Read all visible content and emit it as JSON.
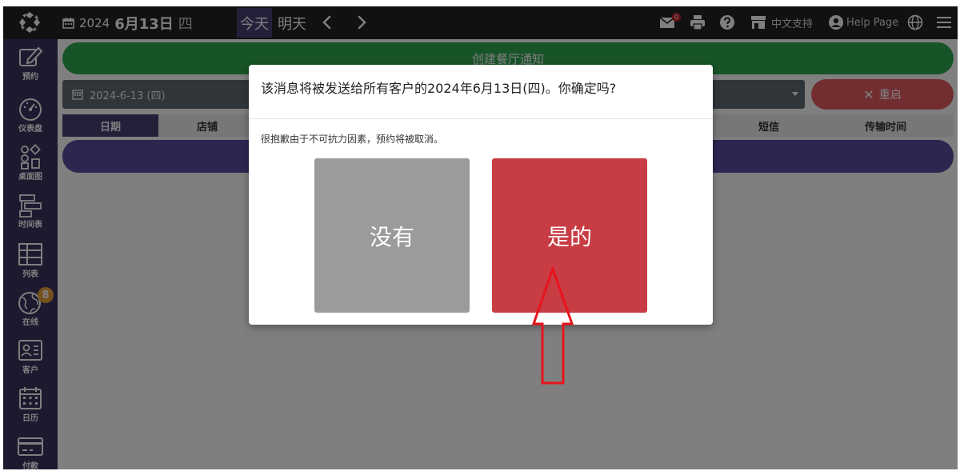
{
  "topbar": {
    "date_year": "2024",
    "date_md": "6月13日",
    "date_weekday": "四",
    "today_label": "今天",
    "tomorrow_label": "明天",
    "mail_badge": "0",
    "chinese_support_label": "中文支持",
    "help_page_label": "Help Page"
  },
  "sidebar": {
    "items": [
      {
        "label": "预约",
        "icon": "edit-icon"
      },
      {
        "label": "仪表盘",
        "icon": "dashboard-gauge-icon"
      },
      {
        "label": "桌面图",
        "icon": "table-layout-icon"
      },
      {
        "label": "时间表",
        "icon": "timeline-icon"
      },
      {
        "label": "列表",
        "icon": "list-table-icon"
      },
      {
        "label": "在线",
        "icon": "globe-icon",
        "badge": "8"
      },
      {
        "label": "客户",
        "icon": "contact-card-icon"
      },
      {
        "label": "日历",
        "icon": "calendar-icon"
      },
      {
        "label": "付款",
        "icon": "credit-card-icon"
      }
    ]
  },
  "content": {
    "create_notice_label": "创建餐厅通知",
    "date_select_value": "2024-6-13 (四)",
    "reset_label": "重启",
    "columns": [
      "日期",
      "店铺",
      "",
      "",
      "",
      "",
      "",
      "短信",
      "传输时间"
    ]
  },
  "modal": {
    "title": "该消息将被发送给所有客户的2024年6月13日(四)。你确定吗?",
    "message": "很抱歉由于不可抗力因素，预约将被取消。",
    "no_label": "没有",
    "yes_label": "是的"
  },
  "colors": {
    "topbar": "#222222",
    "sidebar": "#3b335e",
    "accent_purple": "#4a4175",
    "green": "#2ea84f",
    "yes_red": "#c83c44",
    "no_gray": "#9b9b9b",
    "annotation_arrow": "#e8141c"
  }
}
